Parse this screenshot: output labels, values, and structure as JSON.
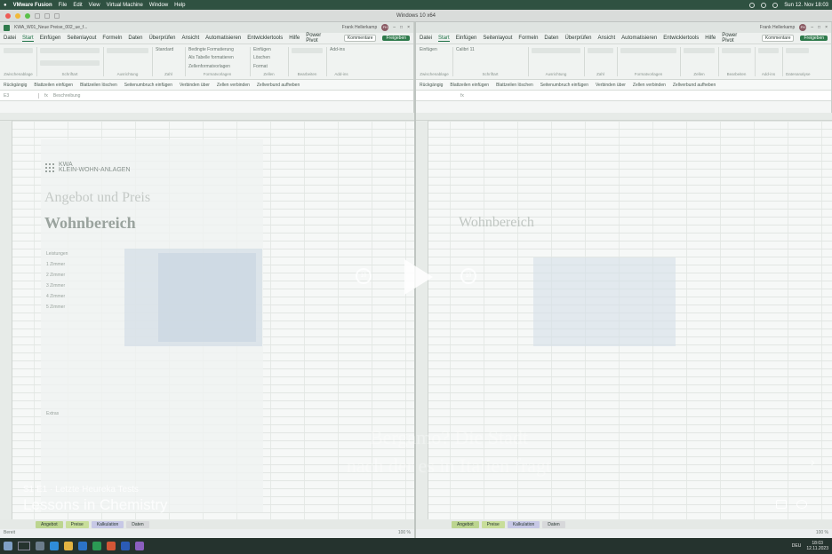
{
  "mac_menu": {
    "app": "VMware Fusion",
    "items": [
      "File",
      "Edit",
      "View",
      "Virtual Machine",
      "Window",
      "Help"
    ],
    "clock": "Sun 12. Nov 18:03"
  },
  "vm_window": {
    "title": "Windows 10 x64"
  },
  "excel_left": {
    "file_title": "KWA_W01_Neue Preise_002_ue_f...",
    "user": "Frank Hellerkamp",
    "user_initials": "FH",
    "tabs": [
      "Datei",
      "Start",
      "Einfügen",
      "Seitenlayout",
      "Formeln",
      "Daten",
      "Überprüfen",
      "Ansicht",
      "Automatisieren",
      "Entwicklertools",
      "Hilfe",
      "Power Pivot"
    ],
    "active_tab": "Start",
    "comments_btn": "Kommentare",
    "share_btn": "Freigeben",
    "ribbon_groups": [
      "Zwischenablage",
      "Schriftart",
      "Ausrichtung",
      "Zahl",
      "Formatvorlagen",
      "Zellen",
      "Bearbeiten",
      "Add-ins"
    ],
    "ribbon_items": {
      "cond_format": "Bedingte Formatierung",
      "as_table": "Als Tabelle formatieren",
      "cell_styles": "Zellenformatvorlagen",
      "insert": "Einfügen",
      "delete": "Löschen",
      "format": "Format",
      "number_format": "Standard",
      "add_ins": "Add-ins"
    },
    "quick_actions": [
      "Rückgängig",
      "Blattzeilen einfügen",
      "Blattzeilen löschen",
      "Seitenumbruch einfügen",
      "Verbinden über",
      "Zellen verbinden",
      "Zellverbund aufheben"
    ],
    "name_box": "E3",
    "formula_text": "Beschreibung",
    "doc": {
      "logo_line1": "KWA",
      "logo_line2": "KLEIN-WOHN-ANLAGEN",
      "heading": "Angebot und Preis",
      "section": "Wohnbereich",
      "labels": [
        "Leistungen",
        "1 Zimmer",
        "2 Zimmer",
        "3 Zimmer",
        "4 Zimmer",
        "5 Zimmer",
        "Extras"
      ]
    },
    "sheet_tabs": [
      "Angebot",
      "Preise",
      "Kalkulation",
      "Daten"
    ],
    "status_left": "Bereit",
    "status_right": "100 %"
  },
  "excel_right": {
    "user": "Frank Hellerkamp",
    "user_initials": "FH",
    "tabs": [
      "Datei",
      "Start",
      "Einfügen",
      "Seitenlayout",
      "Formeln",
      "Daten",
      "Überprüfen",
      "Ansicht",
      "Automatisieren",
      "Entwicklertools",
      "Hilfe",
      "Power Pivot"
    ],
    "active_tab": "Start",
    "comments_btn": "Kommentare",
    "share_btn": "Freigeben",
    "ribbon_groups": [
      "Zwischenablage",
      "Schriftart",
      "Ausrichtung",
      "Zahl",
      "Formatvorlagen",
      "Zellen",
      "Bearbeiten",
      "Add-ins",
      "Datenanalyse"
    ],
    "font_name": "Calibri",
    "font_size": "11",
    "paste": "Einfügen",
    "quick_actions": [
      "Rückgängig",
      "Blattzeilen einfügen",
      "Blattzeilen löschen",
      "Seitenumbruch einfügen",
      "Verbinden über",
      "Zellen verbinden",
      "Zellverbund aufheben"
    ],
    "section": "Wohnbereich",
    "sheet_tabs": [
      "Angebot",
      "Preise",
      "Kalkulation",
      "Daten"
    ],
    "status_right": "100 %"
  },
  "video_overlay": {
    "episode": "S1 E1 · Letzte Heureka Tests",
    "show_title": "Lessons in Chemistry",
    "subtitle_line1": "Bergamo? Die Stadt",
    "subtitle_line2": "nach der es in Italien fragt",
    "skip_back": "10",
    "skip_fwd": "10"
  },
  "taskbar": {
    "time": "18:03",
    "date": "12.11.2023",
    "lang": "DEU"
  },
  "colors": {
    "excel_green": "#2e7a4b",
    "mac_bar": "#2f5141",
    "taskbar": "#25332e"
  }
}
